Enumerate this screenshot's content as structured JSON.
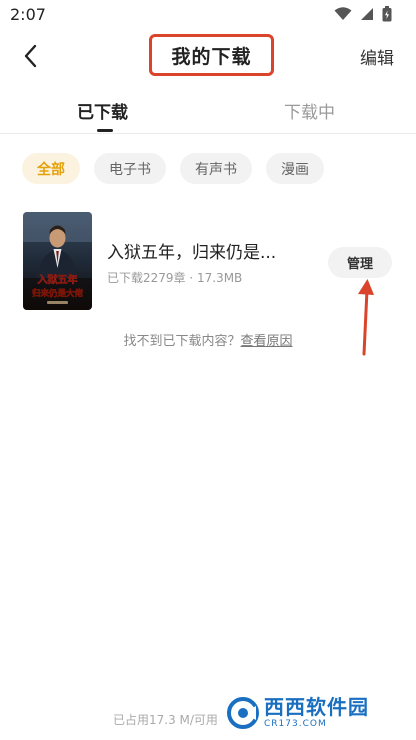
{
  "status_bar": {
    "time": "2:07"
  },
  "header": {
    "title": "我的下载",
    "edit_label": "编辑"
  },
  "tabs": [
    {
      "label": "已下载",
      "active": true
    },
    {
      "label": "下载中",
      "active": false
    }
  ],
  "filters": [
    {
      "label": "全部",
      "active": true
    },
    {
      "label": "电子书",
      "active": false
    },
    {
      "label": "有声书",
      "active": false
    },
    {
      "label": "漫画",
      "active": false
    }
  ],
  "books": [
    {
      "title": "入狱五年，归来仍是...",
      "meta": "已下载2279章 · 17.3MB",
      "manage_label": "管理",
      "cover_text_line1": "入狱五年",
      "cover_text_line2": "归来仍是大佬"
    }
  ],
  "help": {
    "prefix": "找不到已下载内容？",
    "link": "查看原因"
  },
  "storage_text": "已占用17.3 M/可用",
  "watermark": {
    "main": "西西软件园",
    "sub": "CR173.COM"
  },
  "colors": {
    "accent": "#e5a10e",
    "annotation": "#d9442b",
    "watermark": "#1a6fc1"
  }
}
